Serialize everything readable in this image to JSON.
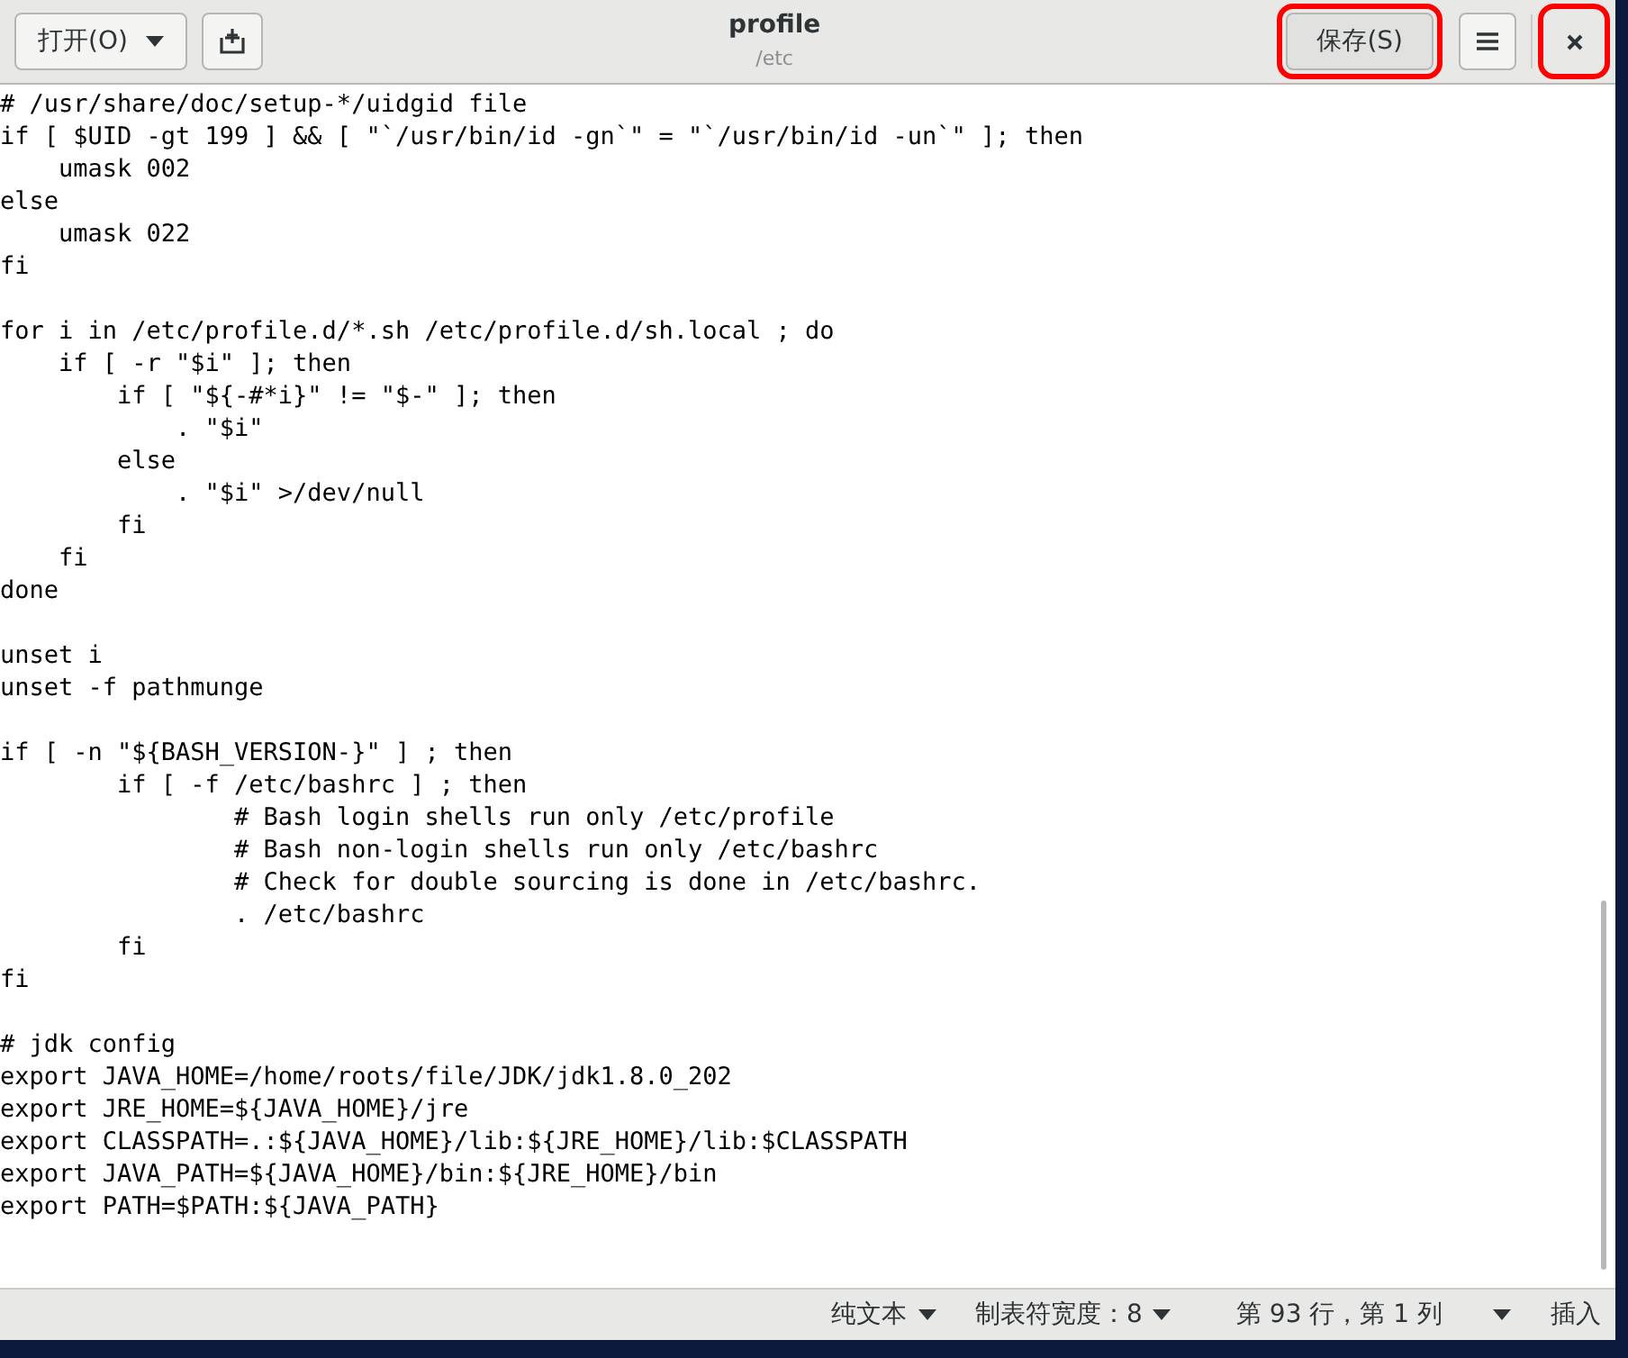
{
  "header": {
    "open_button": "打开(O)",
    "title": "profile",
    "subtitle": "/etc",
    "save_button": {
      "label": "保存(S)",
      "highlighted": true
    },
    "close_highlighted": true
  },
  "editor": {
    "blocks": [
      [
        "# /usr/share/doc/setup-*/uidgid file",
        "if [ $UID -gt 199 ] && [ \"`/usr/bin/id -gn`\" = \"`/usr/bin/id -un`\" ]; then",
        "    umask 002",
        "else",
        "    umask 022",
        "fi"
      ],
      [
        "for i in /etc/profile.d/*.sh /etc/profile.d/sh.local ; do",
        "    if [ -r \"$i\" ]; then",
        "        if [ \"${-#*i}\" != \"$-\" ]; then",
        "            . \"$i\"",
        "        else",
        "            . \"$i\" >/dev/null",
        "        fi",
        "    fi",
        "done"
      ],
      [
        "unset i",
        "unset -f pathmunge"
      ],
      [
        "if [ -n \"${BASH_VERSION-}\" ] ; then",
        "        if [ -f /etc/bashrc ] ; then",
        "                # Bash login shells run only /etc/profile",
        "                # Bash non-login shells run only /etc/bashrc",
        "                # Check for double sourcing is done in /etc/bashrc.",
        "                . /etc/bashrc",
        "        fi",
        "fi"
      ],
      [
        "# jdk config",
        "export JAVA_HOME=/home/roots/file/JDK/jdk1.8.0_202",
        "export JRE_HOME=${JAVA_HOME}/jre",
        "export CLASSPATH=.:${JAVA_HOME}/lib:${JRE_HOME}/lib:$CLASSPATH",
        "export JAVA_PATH=${JAVA_HOME}/bin:${JRE_HOME}/bin",
        "export PATH=$PATH:${JAVA_PATH}"
      ]
    ]
  },
  "status_bar": {
    "language": "纯文本",
    "tab_width": "制表符宽度：8",
    "position": "第 93 行，第 1 列",
    "mode": "插入"
  }
}
